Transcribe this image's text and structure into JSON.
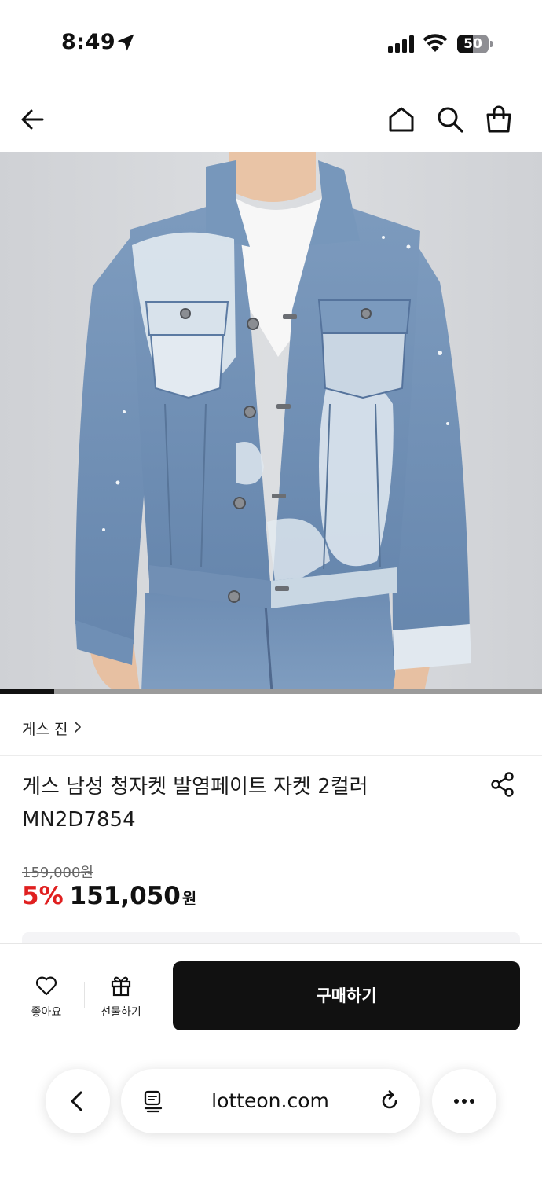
{
  "status_bar": {
    "time": "8:49",
    "battery": "50",
    "battery_level": 0.5,
    "icons": [
      "location-arrow-icon",
      "cellular-signal-icon",
      "wifi-icon",
      "battery-icon"
    ]
  },
  "header": {
    "icons": [
      "back-arrow-icon",
      "home-icon",
      "search-icon",
      "shopping-bag-icon"
    ]
  },
  "product": {
    "image": {
      "subject": "denim-jacket-photo",
      "carousel_position": 0.1
    },
    "brand": "게스 진",
    "title": "게스 남성 청자켓 발염페이트 자켓 2컬러 MN2D7854",
    "original_price": "159,000원",
    "discount": "5%",
    "price": "151,050",
    "currency": "원"
  },
  "action_bar": {
    "like_label": "좋아요",
    "gift_label": "선물하기",
    "buy_label": "구매하기"
  },
  "browser": {
    "url": "lotteon.com",
    "icons": [
      "back-chevron-icon",
      "reader-icon",
      "reload-icon",
      "more-icon"
    ]
  },
  "colors": {
    "accent_discount": "#e02020",
    "button_dark": "#111111",
    "background": "#ffffff"
  }
}
